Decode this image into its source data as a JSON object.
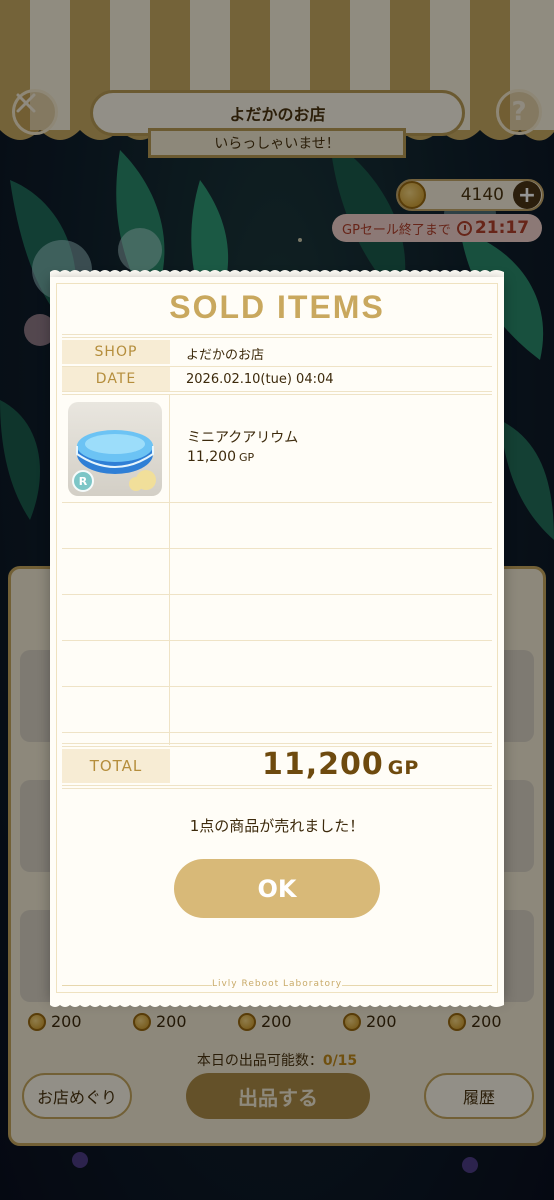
{
  "header": {
    "shop_name": "よだかのお店",
    "greeting": "いらっしゃいませ！",
    "close_icon": "close-icon",
    "help_label": "?"
  },
  "wallet": {
    "gp_balance": "4140",
    "add_label": "+",
    "sale_label": "GPセール終了まで",
    "sale_time": "21:17"
  },
  "background_shop": {
    "prices": [
      "200",
      "200",
      "200",
      "200",
      "200"
    ],
    "daily_limit_label": "本日の出品可能数：",
    "daily_limit_value": "0/15",
    "tour_button": "お店めぐり",
    "list_button": "出品する",
    "history_button": "履歴"
  },
  "receipt": {
    "title": "SOLD ITEMS",
    "shop_label": "SHOP",
    "shop_value": "よだかのお店",
    "date_label": "DATE",
    "date_value": "2026.02.10(tue) 04:04",
    "items": [
      {
        "name": "ミニアクアリウム",
        "price": "11,200",
        "unit": "GP",
        "rarity": "R"
      }
    ],
    "total_label": "TOTAL",
    "total_value": "11,200",
    "total_unit": "GP",
    "message": "1点の商品が売れました！",
    "ok_button": "OK",
    "footer": "Livly Reboot Laboratory"
  },
  "colors": {
    "accent_gold": "#c9a85e",
    "ok_button": "#d8b978",
    "sale_red": "#b2402c"
  }
}
